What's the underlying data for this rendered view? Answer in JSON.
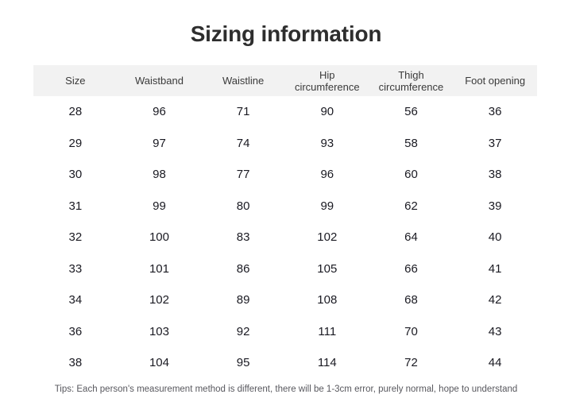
{
  "page": {
    "title": "Sizing information",
    "background_color": "#ffffff",
    "title_color": "#2e2e2e",
    "header_band_color": "#f2f2f2",
    "cell_text_color": "#1a1a22",
    "tips_text_color": "#58585e"
  },
  "table": {
    "columns": [
      {
        "label": "Size",
        "line1": "Size",
        "line2": ""
      },
      {
        "label": "Waistband",
        "line1": "Waistband",
        "line2": ""
      },
      {
        "label": "Waistline",
        "line1": "Waistline",
        "line2": ""
      },
      {
        "label": "Hip circumference",
        "line1": "Hip",
        "line2": "circumference"
      },
      {
        "label": "Thigh circumference",
        "line1": "Thigh",
        "line2": "circumference"
      },
      {
        "label": "Foot opening",
        "line1": "Foot opening",
        "line2": ""
      }
    ],
    "rows": [
      {
        "size": "28",
        "waistband": "96",
        "waistline": "71",
        "hip": "90",
        "thigh": "56",
        "foot": "36"
      },
      {
        "size": "29",
        "waistband": "97",
        "waistline": "74",
        "hip": "93",
        "thigh": "58",
        "foot": "37"
      },
      {
        "size": "30",
        "waistband": "98",
        "waistline": "77",
        "hip": "96",
        "thigh": "60",
        "foot": "38"
      },
      {
        "size": "31",
        "waistband": "99",
        "waistline": "80",
        "hip": "99",
        "thigh": "62",
        "foot": "39"
      },
      {
        "size": "32",
        "waistband": "100",
        "waistline": "83",
        "hip": "102",
        "thigh": "64",
        "foot": "40"
      },
      {
        "size": "33",
        "waistband": "101",
        "waistline": "86",
        "hip": "105",
        "thigh": "66",
        "foot": "41"
      },
      {
        "size": "34",
        "waistband": "102",
        "waistline": "89",
        "hip": "108",
        "thigh": "68",
        "foot": "42"
      },
      {
        "size": "36",
        "waistband": "103",
        "waistline": "92",
        "hip": "111",
        "thigh": "70",
        "foot": "43"
      },
      {
        "size": "38",
        "waistband": "104",
        "waistline": "95",
        "hip": "114",
        "thigh": "72",
        "foot": "44"
      }
    ]
  },
  "tips": {
    "text": "Tips: Each person's measurement method is different, there will be 1-3cm error, purely normal, hope to understand"
  }
}
